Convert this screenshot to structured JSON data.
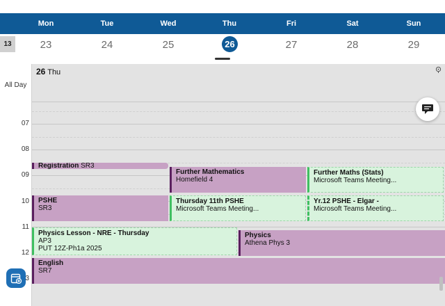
{
  "week": {
    "number": "13",
    "days": [
      {
        "name": "Mon",
        "date": "23"
      },
      {
        "name": "Tue",
        "date": "24"
      },
      {
        "name": "Wed",
        "date": "25"
      },
      {
        "name": "Thu",
        "date": "26"
      },
      {
        "name": "Fri",
        "date": "27"
      },
      {
        "name": "Sat",
        "date": "28"
      },
      {
        "name": "Sun",
        "date": "29"
      }
    ],
    "selected_date": "26"
  },
  "day_view": {
    "date_number": "26",
    "date_day": "Thu",
    "all_day_label": "All Day",
    "hours": [
      "07",
      "08",
      "09",
      "10",
      "11",
      "12",
      "13"
    ]
  },
  "events": {
    "registration": {
      "title": "Registration",
      "room": "SR3"
    },
    "further_math": {
      "title": "Further Mathematics",
      "location": "Homefield 4"
    },
    "further_stats": {
      "title": "Further Maths (Stats)",
      "location": "Microsoft Teams Meeting..."
    },
    "pshe": {
      "title": "PSHE",
      "location": "SR3"
    },
    "thursday_pshe": {
      "title": "Thursday 11th PSHE",
      "location": "Microsoft Teams Meeting..."
    },
    "yr12_pshe": {
      "title": "Yr.12 PSHE - Elgar -",
      "location": "Microsoft Teams Meeting..."
    },
    "physics_lesson": {
      "title": "Physics Lesson - NRE - Thursday",
      "line2": "AP3",
      "line3": "PUT 12Z-Ph1a 2025"
    },
    "physics": {
      "title": "Physics",
      "location": "Athena Phys 3"
    },
    "english": {
      "title": "English",
      "location": "SR7"
    }
  },
  "colors": {
    "header_blue": "#0f5a96",
    "event_purple": "#c7a1c4",
    "event_green": "#d8f3dd",
    "accent_green": "#3fbf61"
  },
  "icons": [
    "pin-icon",
    "chat-icon",
    "calendar-add-icon"
  ]
}
